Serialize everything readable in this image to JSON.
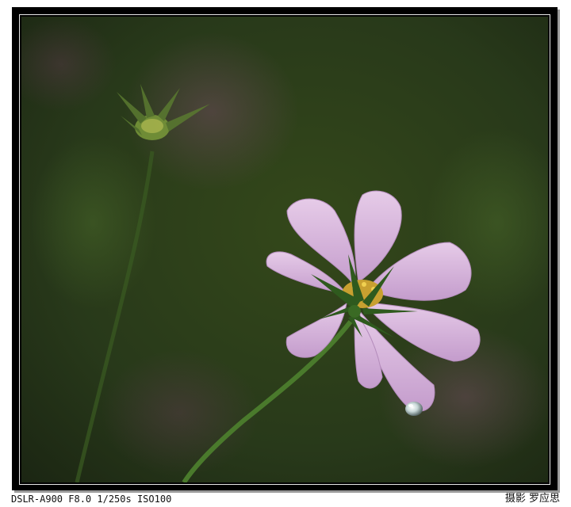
{
  "photo": {
    "exif_caption": "DSLR-A900 F8.0 1/250s ISO100",
    "credit": "摄影  罗应思",
    "subject": "pink cosmos flower with water droplet",
    "colors": {
      "background_dark": "#1e2a12",
      "background_mid": "#2f4218",
      "petal": "#d8b8dc",
      "petal_shade": "#b48cbc",
      "stem": "#3f6a28",
      "center": "#e0c040"
    }
  }
}
